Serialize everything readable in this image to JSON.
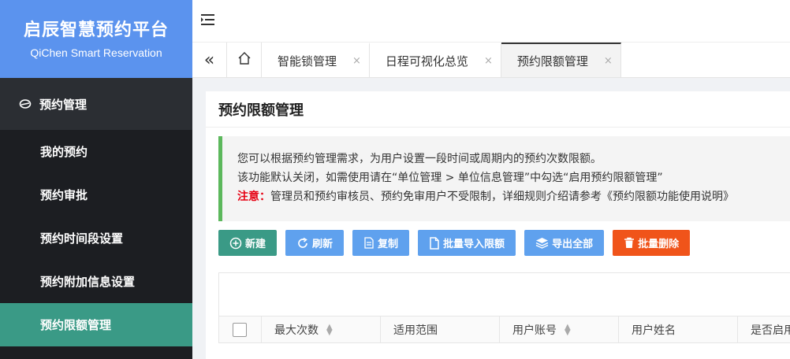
{
  "brand": {
    "title": "启辰智慧预约平台",
    "subtitle": "QiChen Smart Reservation"
  },
  "sidebar": {
    "group": {
      "label": "预约管理",
      "icon": "link-icon"
    },
    "items": [
      {
        "label": "我的预约",
        "active": false
      },
      {
        "label": "预约审批",
        "active": false
      },
      {
        "label": "预约时间段设置",
        "active": false
      },
      {
        "label": "预约附加信息设置",
        "active": false
      },
      {
        "label": "预约限额管理",
        "active": true
      }
    ]
  },
  "tabs": [
    {
      "label": "智能锁管理",
      "close": "×"
    },
    {
      "label": "日程可视化总览",
      "close": "×"
    },
    {
      "label": "预约限额管理",
      "close": "×",
      "active": true
    }
  ],
  "tab_nav": {
    "back": "«"
  },
  "page": {
    "title": "预约限额管理",
    "notice": {
      "line1": "您可以根据预约管理需求，为用户设置一段时间或周期内的预约次数限额。",
      "line2": "该功能默认关闭，如需使用请在“单位管理 > 单位信息管理”中勾选“启用预约限额管理”",
      "warn_label": "注意：",
      "line3": "管理员和预约审核员、预约免审用户不受限制，详细规则介绍请参考《预约限额功能使用说明》"
    }
  },
  "toolbar": {
    "new": "新建",
    "refresh": "刷新",
    "copy": "复制",
    "import": "批量导入限额",
    "export": "导出全部",
    "delete": "批量删除"
  },
  "table": {
    "columns": [
      "最大次数",
      "适用范围",
      "用户账号",
      "用户姓名",
      "是否启用"
    ]
  },
  "colors": {
    "brand": "#5b93ee",
    "accent": "#3a9a86",
    "primary_btn": "#5fa1ee",
    "danger": "#f0541a",
    "warning_text": "#e60012"
  }
}
